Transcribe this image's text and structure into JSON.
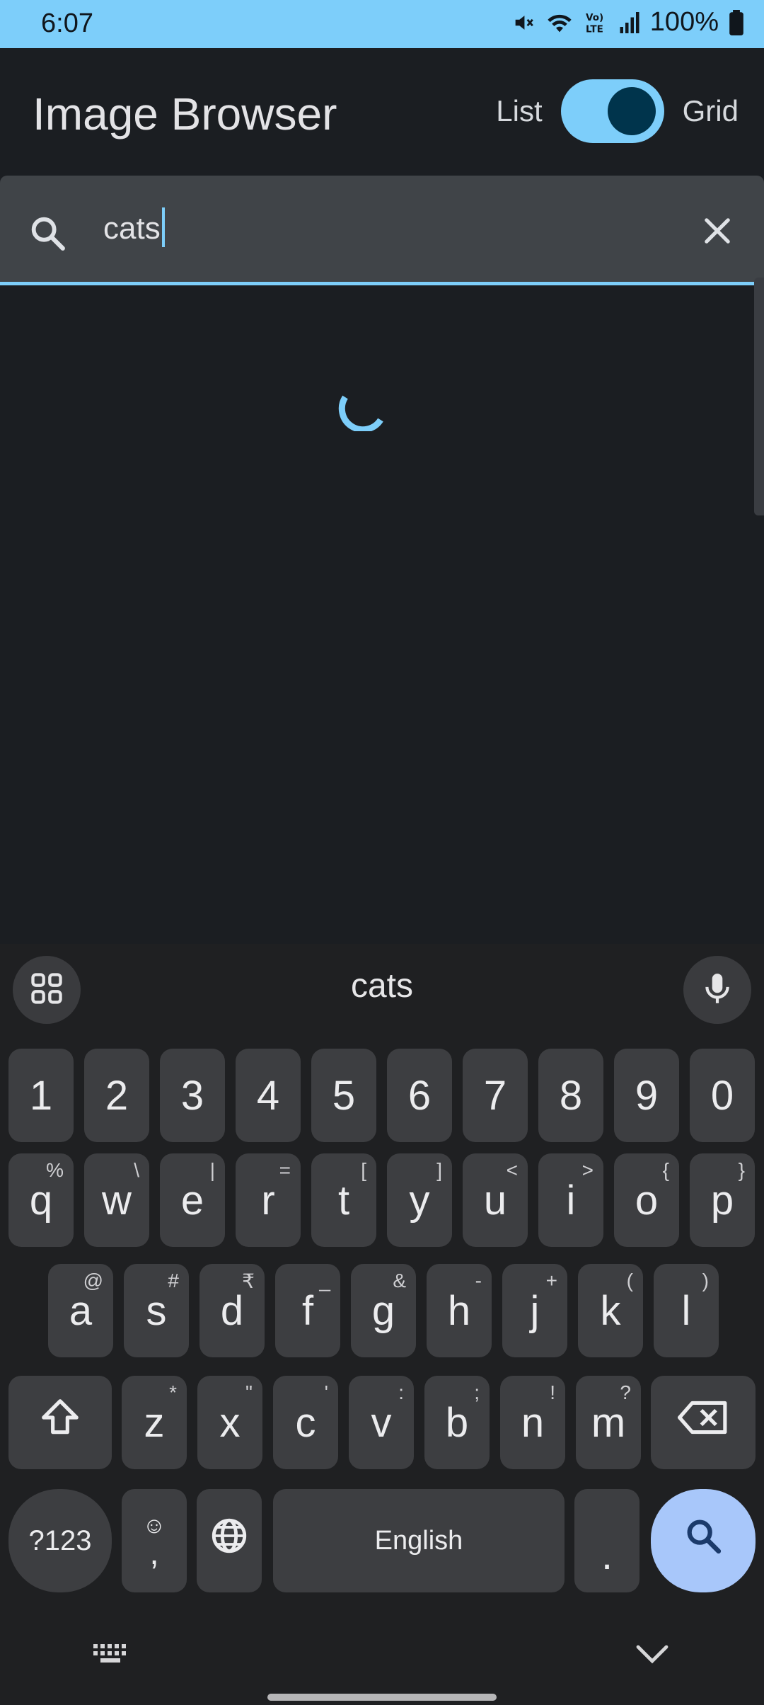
{
  "status_bar": {
    "time": "6:07",
    "battery": "100%",
    "icons": [
      "mute-icon",
      "wifi-icon",
      "volte-icon",
      "signal-icon",
      "battery-icon"
    ]
  },
  "app": {
    "title": "Image Browser",
    "toggle_left_label": "List",
    "toggle_right_label": "Grid",
    "toggle_state": "on"
  },
  "search": {
    "value": "cats",
    "icon": "search-icon",
    "clear_icon": "close-icon"
  },
  "content": {
    "state": "loading"
  },
  "keyboard": {
    "suggestion": "cats",
    "rows": {
      "numbers": [
        "1",
        "2",
        "3",
        "4",
        "5",
        "6",
        "7",
        "8",
        "9",
        "0"
      ],
      "row1": [
        {
          "key": "q",
          "hint": "%"
        },
        {
          "key": "w",
          "hint": "\\"
        },
        {
          "key": "e",
          "hint": "|"
        },
        {
          "key": "r",
          "hint": "="
        },
        {
          "key": "t",
          "hint": "["
        },
        {
          "key": "y",
          "hint": "]"
        },
        {
          "key": "u",
          "hint": "<"
        },
        {
          "key": "i",
          "hint": ">"
        },
        {
          "key": "o",
          "hint": "{"
        },
        {
          "key": "p",
          "hint": "}"
        }
      ],
      "row2": [
        {
          "key": "a",
          "hint": "@"
        },
        {
          "key": "s",
          "hint": "#"
        },
        {
          "key": "d",
          "hint": "₹"
        },
        {
          "key": "f",
          "hint": "_"
        },
        {
          "key": "g",
          "hint": "&"
        },
        {
          "key": "h",
          "hint": "-"
        },
        {
          "key": "j",
          "hint": "+"
        },
        {
          "key": "k",
          "hint": "("
        },
        {
          "key": "l",
          "hint": ")"
        }
      ],
      "row3": [
        {
          "key": "z",
          "hint": "*"
        },
        {
          "key": "x",
          "hint": "\""
        },
        {
          "key": "c",
          "hint": "'"
        },
        {
          "key": "v",
          "hint": ":"
        },
        {
          "key": "b",
          "hint": ";"
        },
        {
          "key": "n",
          "hint": "!"
        },
        {
          "key": "m",
          "hint": "?"
        }
      ]
    },
    "symbols_label": "?123",
    "comma_label": ",",
    "space_label": "English",
    "period_label": "."
  },
  "colors": {
    "accent": "#7dcefa",
    "background": "#1b1e22",
    "search_field": "#404448",
    "keyboard_bg": "#1f2022",
    "key_bg": "#3d3e41",
    "search_key": "#a8c7fa"
  }
}
